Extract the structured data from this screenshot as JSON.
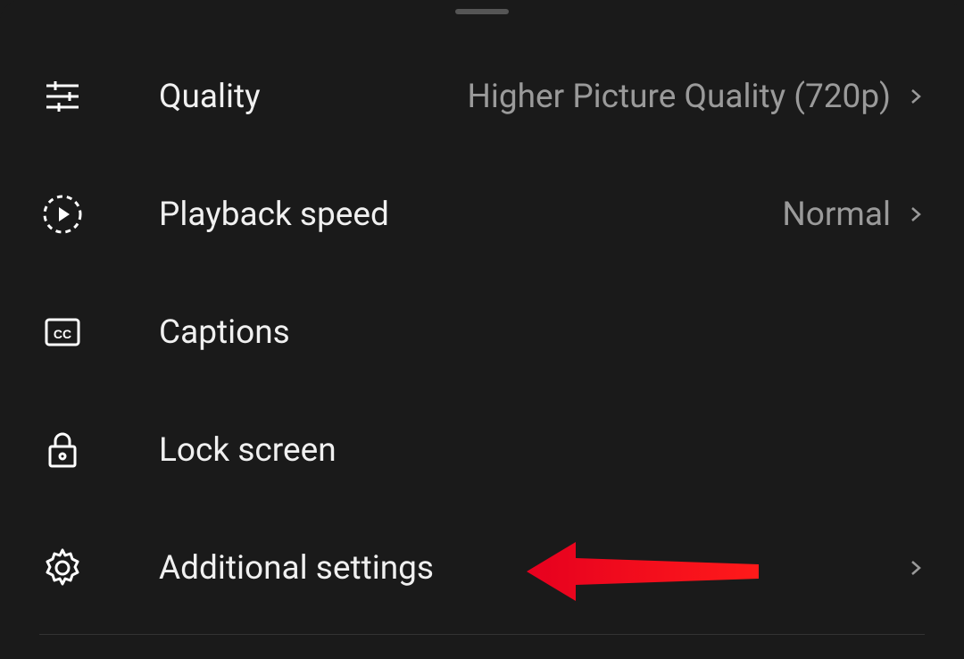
{
  "menu": {
    "items": [
      {
        "key": "quality",
        "label": "Quality",
        "value": "Higher Picture Quality (720p)",
        "has_value": true,
        "has_chevron": true
      },
      {
        "key": "playback-speed",
        "label": "Playback speed",
        "value": "Normal",
        "has_value": true,
        "has_chevron": true
      },
      {
        "key": "captions",
        "label": "Captions",
        "value": "",
        "has_value": false,
        "has_chevron": false
      },
      {
        "key": "lock-screen",
        "label": "Lock screen",
        "value": "",
        "has_value": false,
        "has_chevron": false
      },
      {
        "key": "additional-settings",
        "label": "Additional settings",
        "value": "",
        "has_value": false,
        "has_chevron": true
      }
    ]
  },
  "annotation": {
    "arrow_color": "#e6001f",
    "target": "additional-settings"
  }
}
